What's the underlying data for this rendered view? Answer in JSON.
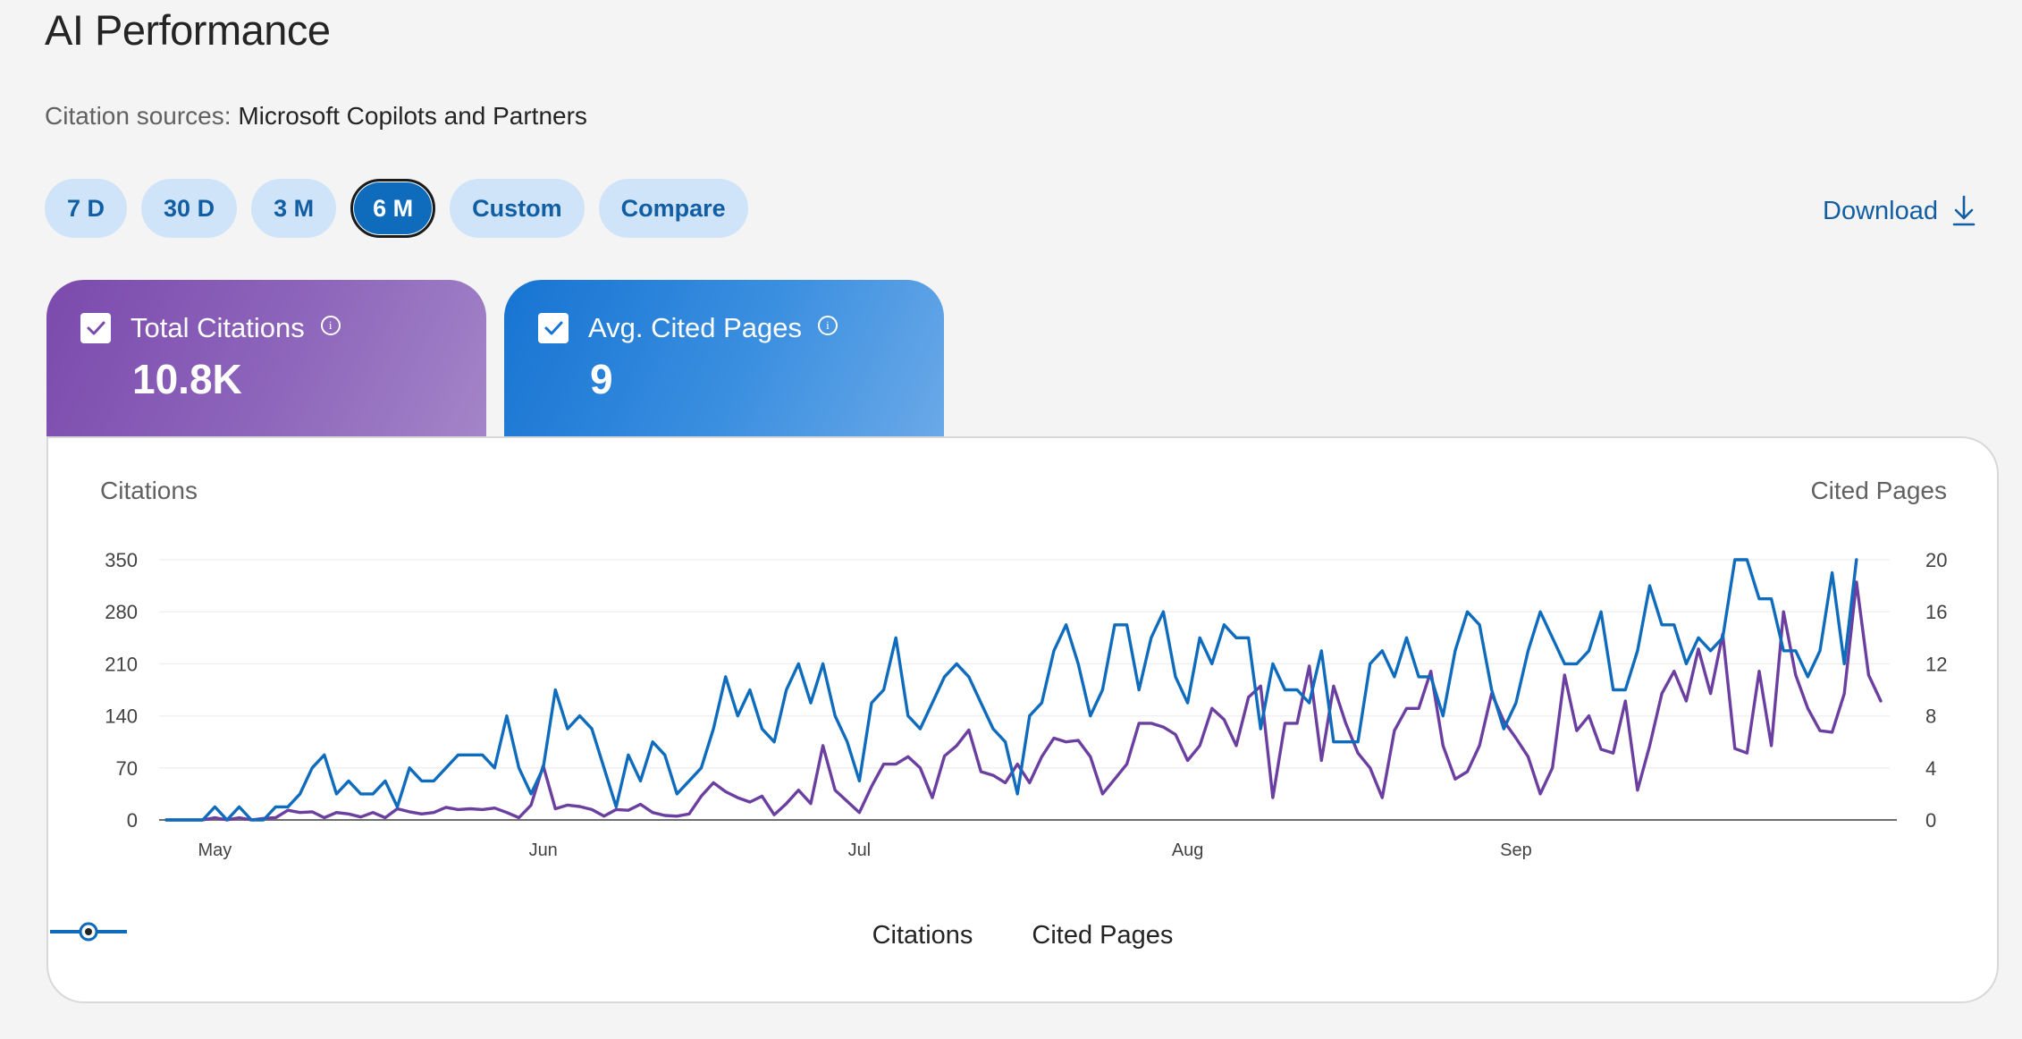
{
  "header": {
    "title": "AI Performance",
    "sources_label": "Citation sources:",
    "sources_value": "Microsoft Copilots and Partners"
  },
  "ranges": [
    "7 D",
    "30 D",
    "3 M",
    "6 M",
    "Custom",
    "Compare"
  ],
  "active_range": "6 M",
  "download_label": "Download",
  "cards": {
    "citations": {
      "label": "Total Citations",
      "value": "10.8K",
      "color": "#7b4aad"
    },
    "pages": {
      "label": "Avg. Cited Pages",
      "value": "9",
      "color": "#1674d2"
    }
  },
  "chart_data": {
    "type": "line",
    "y_left_label": "Citations",
    "y_right_label": "Cited Pages",
    "y_left_ticks": [
      0,
      70,
      140,
      210,
      280,
      350
    ],
    "y_right_ticks": [
      0,
      4,
      8,
      12,
      16,
      20
    ],
    "ylim_left": [
      0,
      350
    ],
    "ylim_right": [
      0,
      20
    ],
    "x_labels": [
      {
        "label": "May",
        "day": 4
      },
      {
        "label": "Jun",
        "day": 31
      },
      {
        "label": "Jul",
        "day": 57
      },
      {
        "label": "Aug",
        "day": 84
      },
      {
        "label": "Sep",
        "day": 111
      }
    ],
    "grid": true,
    "legend": "bottom",
    "series": [
      {
        "name": "Citations",
        "axis": "left",
        "color": "#6b3fa0",
        "values": [
          0,
          0,
          0,
          0,
          3,
          0,
          3,
          0,
          2,
          3,
          13,
          10,
          11,
          3,
          10,
          8,
          4,
          10,
          3,
          15,
          11,
          8,
          10,
          17,
          14,
          15,
          14,
          16,
          10,
          3,
          20,
          73,
          15,
          20,
          18,
          14,
          5,
          14,
          13,
          21,
          10,
          6,
          5,
          8,
          32,
          50,
          38,
          30,
          24,
          32,
          7,
          22,
          40,
          22,
          100,
          40,
          25,
          10,
          45,
          75,
          75,
          85,
          70,
          30,
          86,
          100,
          121,
          65,
          60,
          50,
          75,
          50,
          85,
          110,
          105,
          107,
          85,
          35,
          55,
          75,
          130,
          130,
          125,
          115,
          80,
          100,
          150,
          135,
          100,
          165,
          180,
          30,
          130,
          130,
          207,
          80,
          180,
          130,
          90,
          70,
          30,
          120,
          150,
          150,
          200,
          100,
          55,
          65,
          100,
          170,
          133,
          110,
          85,
          35,
          70,
          195,
          120,
          140,
          95,
          90,
          160,
          40,
          100,
          170,
          200,
          160,
          230,
          170,
          250,
          96,
          90,
          200,
          100,
          280,
          195,
          150,
          120,
          118,
          170,
          320,
          195,
          160
        ]
      },
      {
        "name": "Cited Pages",
        "axis": "right",
        "color": "#0f6cbd",
        "values": [
          0,
          0,
          0,
          0,
          1,
          0,
          1,
          0,
          0,
          1,
          1,
          2,
          4,
          5,
          2,
          3,
          2,
          2,
          3,
          1,
          4,
          3,
          3,
          4,
          5,
          5,
          5,
          4,
          8,
          4,
          2,
          4,
          10,
          7,
          8,
          7,
          4,
          1,
          5,
          3,
          6,
          5,
          2,
          3,
          4,
          7,
          11,
          8,
          10,
          7,
          6,
          10,
          12,
          9,
          12,
          8,
          6,
          3,
          9,
          10,
          14,
          8,
          7,
          9,
          11,
          12,
          11,
          9,
          7,
          6,
          2,
          8,
          9,
          13,
          15,
          12,
          8,
          10,
          15,
          15,
          10,
          14,
          16,
          11,
          9,
          14,
          12,
          15,
          14,
          14,
          7,
          12,
          10,
          10,
          9,
          13,
          6,
          6,
          6,
          12,
          13,
          11,
          14,
          11,
          11,
          8,
          13,
          16,
          15,
          10,
          7,
          9,
          13,
          16,
          14,
          12,
          12,
          13,
          16,
          10,
          10,
          13,
          18,
          15,
          15,
          12,
          14,
          13,
          14,
          20,
          20,
          17,
          17,
          13,
          13,
          11,
          13,
          19,
          12,
          20
        ]
      }
    ]
  }
}
